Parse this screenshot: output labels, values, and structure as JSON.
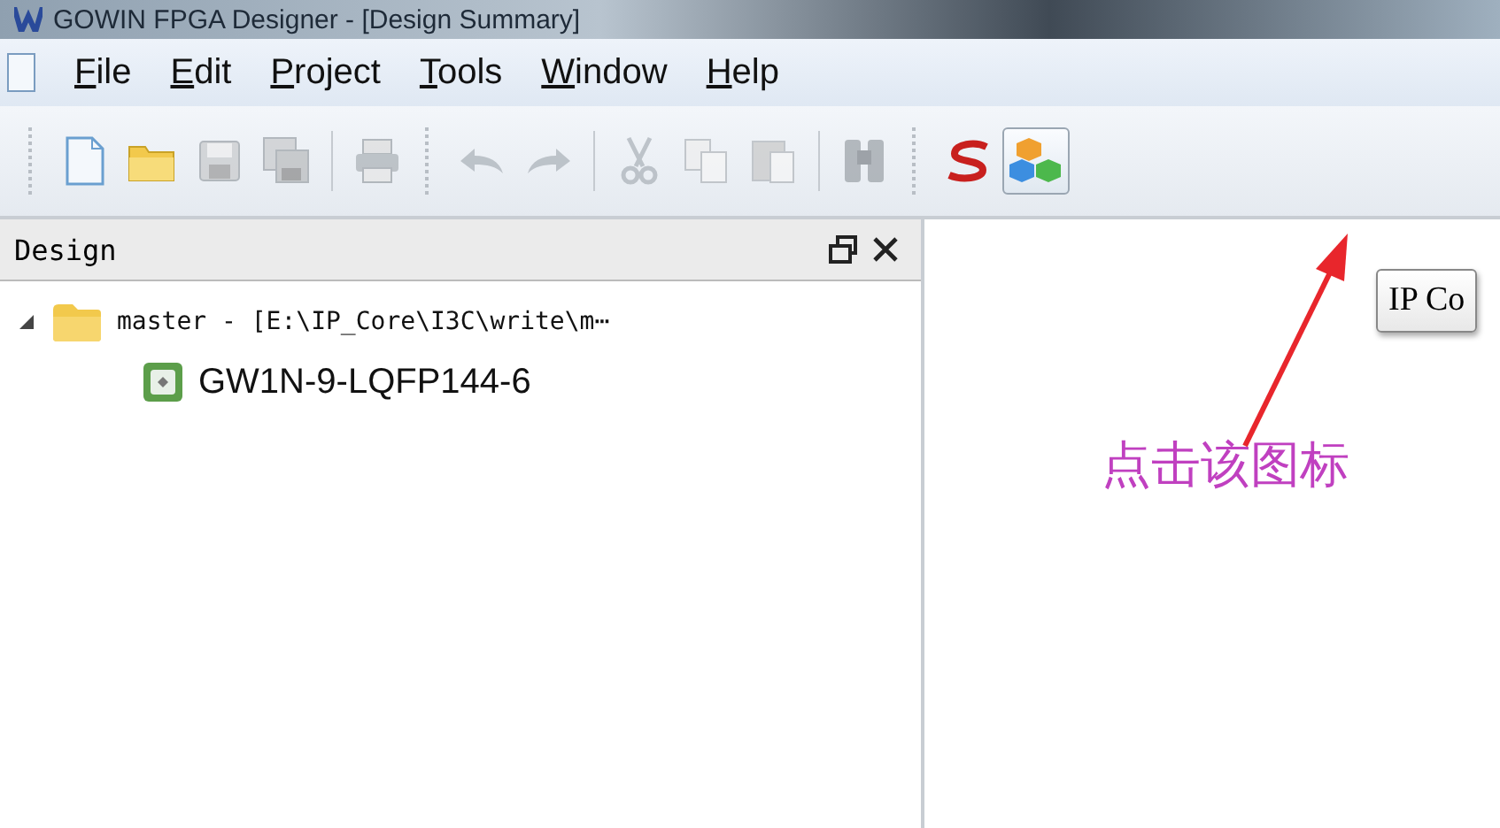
{
  "window": {
    "title": "GOWIN FPGA Designer - [Design Summary]"
  },
  "menu": [
    {
      "label": "File"
    },
    {
      "label": "Edit"
    },
    {
      "label": "Project"
    },
    {
      "label": "Tools"
    },
    {
      "label": "Window"
    },
    {
      "label": "Help"
    }
  ],
  "toolbar": {
    "groups": [
      [
        {
          "kind": "new",
          "disabled": false,
          "highlighted": false
        },
        {
          "kind": "open",
          "disabled": false,
          "highlighted": false
        },
        {
          "kind": "save",
          "disabled": true,
          "highlighted": false
        },
        {
          "kind": "save-all",
          "disabled": true,
          "highlighted": false
        }
      ],
      [
        {
          "kind": "print",
          "disabled": true,
          "highlighted": false
        }
      ],
      [
        {
          "kind": "undo",
          "disabled": true,
          "highlighted": false
        },
        {
          "kind": "redo",
          "disabled": true,
          "highlighted": false
        }
      ],
      [
        {
          "kind": "cut",
          "disabled": true,
          "highlighted": false
        },
        {
          "kind": "copy",
          "disabled": true,
          "highlighted": false
        },
        {
          "kind": "paste",
          "disabled": true,
          "highlighted": false
        }
      ],
      [
        {
          "kind": "find",
          "disabled": true,
          "highlighted": false
        }
      ],
      [
        {
          "kind": "synthesis",
          "disabled": false,
          "highlighted": false
        },
        {
          "kind": "ip-core",
          "disabled": false,
          "highlighted": true
        }
      ]
    ]
  },
  "design_panel": {
    "title": "Design",
    "tree": [
      {
        "label": "master - [E:\\IP_Core\\I3C\\write\\m⋯",
        "kind": "project",
        "expanded": true,
        "children": [
          {
            "label": "GW1N-9-LQFP144-6",
            "kind": "device"
          }
        ]
      }
    ]
  },
  "tooltip": {
    "text": "IP Co"
  },
  "annotation": {
    "text": "点击该图标"
  }
}
